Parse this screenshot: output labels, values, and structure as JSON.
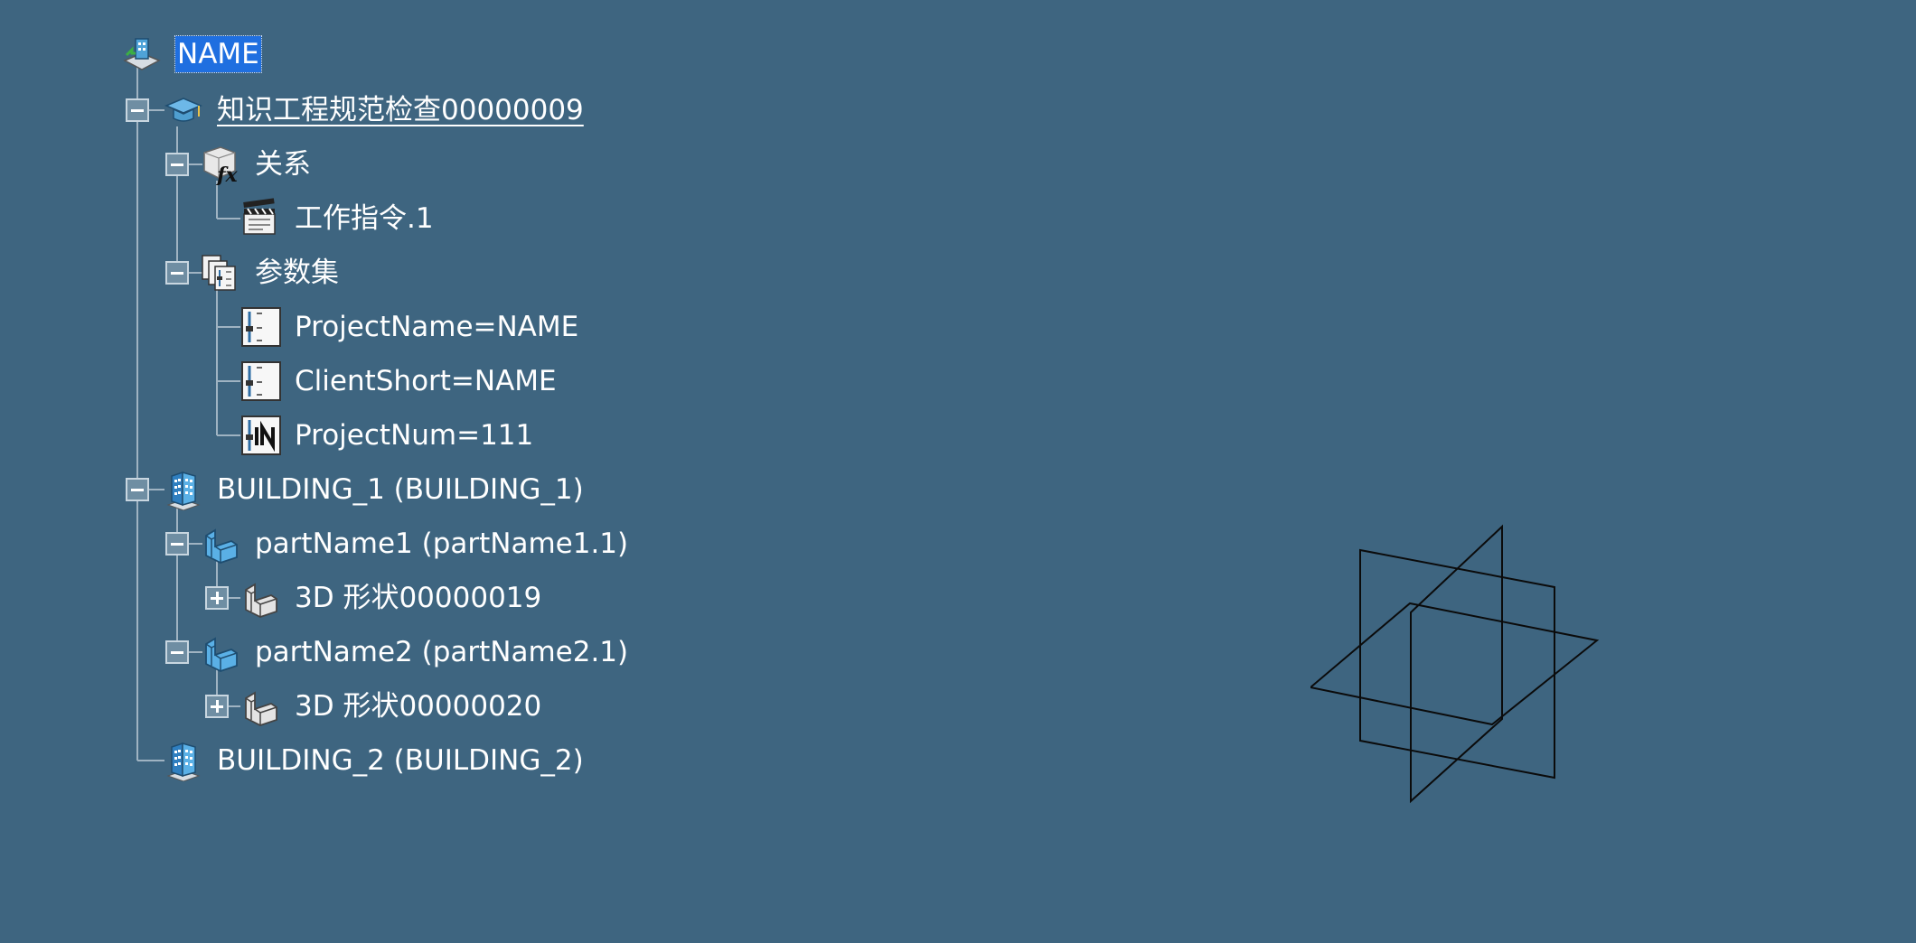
{
  "tree": {
    "root": {
      "label": "NAME",
      "icon": "product-root-icon"
    },
    "knowledge": {
      "label": "知识工程规范检查00000009",
      "icon": "graduation-cap-icon"
    },
    "relations": {
      "label": "关系",
      "icon": "fx-relations-icon"
    },
    "action": {
      "label": "工作指令.1",
      "icon": "clapperboard-icon"
    },
    "paramset": {
      "label": "参数集",
      "icon": "parameter-set-icon"
    },
    "param1": {
      "label": "ProjectName=NAME",
      "icon": "string-parameter-icon"
    },
    "param2": {
      "label": "ClientShort=NAME",
      "icon": "string-parameter-icon"
    },
    "param3": {
      "label": "ProjectNum=111",
      "icon": "integer-parameter-icon"
    },
    "building1": {
      "label": "BUILDING_1 (BUILDING_1)",
      "icon": "building-icon"
    },
    "part1": {
      "label": "partName1 (partName1.1)",
      "icon": "part-icon"
    },
    "shape1": {
      "label": "3D 形状00000019",
      "icon": "shape-3d-icon"
    },
    "part2": {
      "label": "partName2 (partName2.1)",
      "icon": "part-icon"
    },
    "shape2": {
      "label": "3D 形状00000020",
      "icon": "shape-3d-icon"
    },
    "building2": {
      "label": "BUILDING_2 (BUILDING_2)",
      "icon": "building-icon"
    }
  },
  "colors": {
    "background": "#3e6580",
    "selection": "#1f6fe0",
    "tree_line": "#9fb3c2",
    "text": "#ffffff"
  }
}
